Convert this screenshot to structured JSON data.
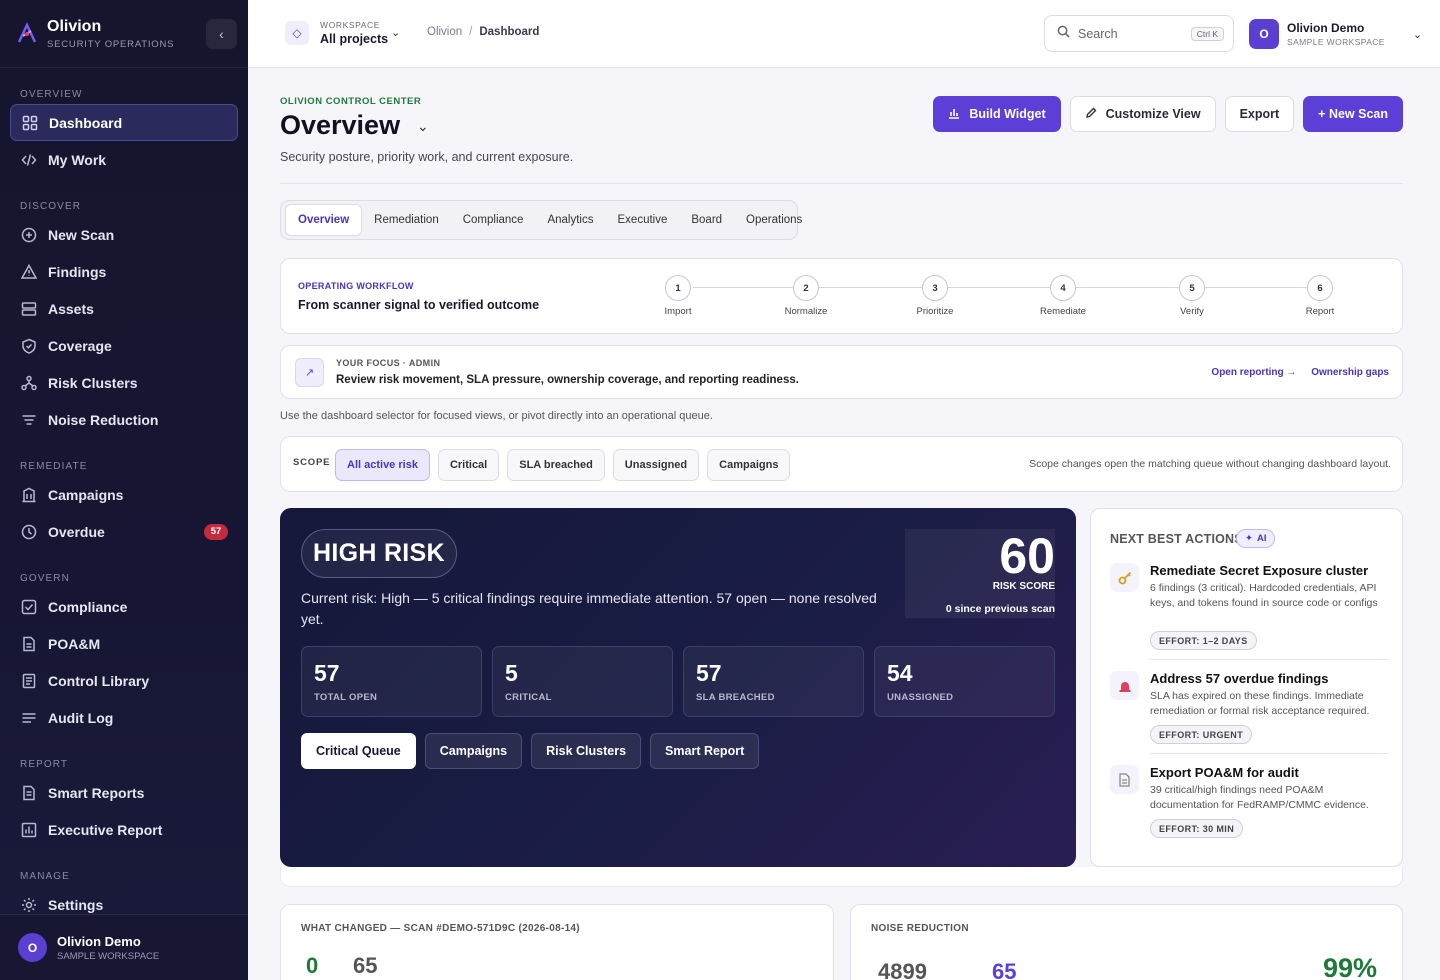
{
  "brand": {
    "name": "Olivion",
    "subtitle": "SECURITY OPERATIONS"
  },
  "sidebar": {
    "sections": {
      "overview": "OVERVIEW",
      "discover": "DISCOVER",
      "remediate": "REMEDIATE",
      "govern": "GOVERN",
      "report": "REPORT",
      "manage": "MANAGE"
    },
    "items": {
      "dashboard": "Dashboard",
      "my_work": "My Work",
      "new_scan": "New Scan",
      "findings": "Findings",
      "assets": "Assets",
      "coverage": "Coverage",
      "risk_clusters": "Risk Clusters",
      "noise_reduction": "Noise Reduction",
      "campaigns": "Campaigns",
      "overdue": "Overdue",
      "compliance": "Compliance",
      "poam": "POA&M",
      "control_library": "Control Library",
      "audit_log": "Audit Log",
      "smart_reports": "Smart Reports",
      "executive_report": "Executive Report",
      "settings": "Settings"
    },
    "overdue_badge": "57",
    "user": {
      "initial": "O",
      "name": "Olivion Demo",
      "workspace": "SAMPLE WORKSPACE"
    }
  },
  "topbar": {
    "workspace_label": "WORKSPACE",
    "workspace_value": "All projects",
    "breadcrumb_root": "Olivion",
    "breadcrumb_sep": "/",
    "breadcrumb_current": "Dashboard",
    "search_placeholder": "Search",
    "search_shortcut": "Ctrl K",
    "user": {
      "initial": "O",
      "name": "Olivion Demo",
      "workspace": "SAMPLE WORKSPACE"
    }
  },
  "header": {
    "eyebrow": "OLIVION CONTROL CENTER",
    "title": "Overview",
    "subtitle": "Security posture, priority work, and current exposure.",
    "buttons": {
      "build_widget": "Build Widget",
      "customize_view": "Customize View",
      "export": "Export",
      "new_scan": "+ New Scan"
    }
  },
  "tabs": [
    "Overview",
    "Remediation",
    "Compliance",
    "Analytics",
    "Executive",
    "Board",
    "Operations"
  ],
  "workflow": {
    "eyebrow": "OPERATING WORKFLOW",
    "title": "From scanner signal to verified outcome",
    "steps": [
      {
        "num": "1",
        "label": "Import"
      },
      {
        "num": "2",
        "label": "Normalize"
      },
      {
        "num": "3",
        "label": "Prioritize"
      },
      {
        "num": "4",
        "label": "Remediate"
      },
      {
        "num": "5",
        "label": "Verify"
      },
      {
        "num": "6",
        "label": "Report"
      }
    ]
  },
  "focus": {
    "eyebrow": "YOUR FOCUS · ADMIN",
    "text": "Review risk movement, SLA pressure, ownership coverage, and reporting readiness.",
    "link_reporting": "Open reporting →",
    "link_ownership": "Ownership gaps"
  },
  "hint": "Use the dashboard selector for focused views, or pivot directly into an operational queue.",
  "scope": {
    "label": "SCOPE",
    "chips": [
      "All active risk",
      "Critical",
      "SLA breached",
      "Unassigned",
      "Campaigns"
    ],
    "note": "Scope changes open the matching queue without changing dashboard layout."
  },
  "risk": {
    "level": "HIGH RISK",
    "description": "Current risk: High — 5 critical findings require immediate attention. 57 open — none resolved yet.",
    "score": "60",
    "score_label": "RISK SCORE",
    "score_change": "0 since previous scan",
    "stats": [
      {
        "value": "57",
        "label": "TOTAL OPEN"
      },
      {
        "value": "5",
        "label": "CRITICAL"
      },
      {
        "value": "57",
        "label": "SLA BREACHED"
      },
      {
        "value": "54",
        "label": "UNASSIGNED"
      }
    ],
    "buttons": [
      "Critical Queue",
      "Campaigns",
      "Risk Clusters",
      "Smart Report"
    ]
  },
  "next_actions": {
    "title": "NEXT BEST ACTIONS",
    "ai_badge": "AI",
    "items": [
      {
        "icon": "key-icon",
        "title": "Remediate Secret Exposure cluster",
        "desc": "6 findings (3 critical). Hardcoded credentials, API keys, and tokens found in source code or configs",
        "effort": "EFFORT: 1–2 DAYS"
      },
      {
        "icon": "siren-icon",
        "title": "Address 57 overdue findings",
        "desc": "SLA has expired on these findings. Immediate remediation or formal risk acceptance required.",
        "effort": "EFFORT: URGENT"
      },
      {
        "icon": "document-icon",
        "title": "Export POA&M for audit",
        "desc": "39 critical/high findings need POA&M documentation for FedRAMP/CMMC evidence.",
        "effort": "EFFORT: 30 MIN"
      }
    ]
  },
  "what_changed": {
    "title": "WHAT CHANGED — SCAN #DEMO-571D9C (2026-08-14)",
    "values": [
      "0",
      "65"
    ]
  },
  "noise": {
    "title": "NOISE REDUCTION",
    "values": [
      "4899",
      "65",
      "99%"
    ]
  },
  "colors": {
    "accent": "#5b3fd6",
    "sidebar_bg": "#15152e",
    "risk_bg": "#15183a",
    "badge_red": "#c42b3d",
    "green": "#1f7a3a"
  }
}
